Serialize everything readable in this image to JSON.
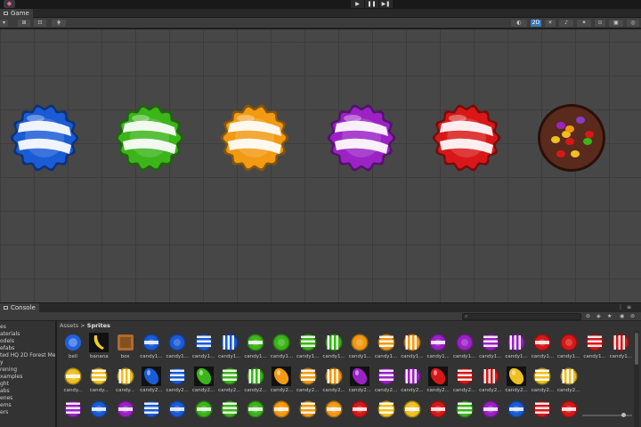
{
  "toolbar": {
    "play": "▶",
    "pause": "❚❚",
    "step": "▶❚"
  },
  "game_tab": {
    "label": "Game"
  },
  "scene_toolbar": {
    "mode_2d": "2D"
  },
  "scene_candies": [
    {
      "name": "blue",
      "color": "#1a5bd6"
    },
    {
      "name": "green",
      "color": "#3bb51a"
    },
    {
      "name": "orange",
      "color": "#f29a12"
    },
    {
      "name": "purple",
      "color": "#9b22c4"
    },
    {
      "name": "red",
      "color": "#d81818"
    },
    {
      "name": "chocolate",
      "color": "#5a2a1c"
    }
  ],
  "console_tab": {
    "label": "Console"
  },
  "project": {
    "breadcrumb_root": "Assets",
    "breadcrumb_sep": ">",
    "breadcrumb_current": "Sprites",
    "search_placeholder": "",
    "tree": [
      "es",
      "aterials",
      "odels",
      "efabs",
      "ted HQ 2D Forest Med",
      "y",
      "rening",
      "xamples",
      "ght",
      "abs",
      "enes",
      "ems",
      "ers"
    ],
    "row1": [
      {
        "label": "bell",
        "color": "#2060e0",
        "kind": "bell"
      },
      {
        "label": "banana",
        "color": "#f0d020",
        "kind": "banana"
      },
      {
        "label": "box",
        "color": "#b06a2c",
        "kind": "box"
      },
      {
        "label": "candy1...",
        "color": "#1a5bd6",
        "kind": "wrap"
      },
      {
        "label": "candy1...",
        "color": "#1a5bd6",
        "kind": "round"
      },
      {
        "label": "candy1...",
        "color": "#1a5bd6",
        "kind": "stripe"
      },
      {
        "label": "candy1...",
        "color": "#1a5bd6",
        "kind": "stripev"
      },
      {
        "label": "candy1...",
        "color": "#3bb51a",
        "kind": "wrap"
      },
      {
        "label": "candy1...",
        "color": "#3bb51a",
        "kind": "round"
      },
      {
        "label": "candy1...",
        "color": "#3bb51a",
        "kind": "stripe"
      },
      {
        "label": "candy1...",
        "color": "#3bb51a",
        "kind": "stripev"
      },
      {
        "label": "candy1...",
        "color": "#f29a12",
        "kind": "round"
      },
      {
        "label": "candy1...",
        "color": "#f29a12",
        "kind": "stripe"
      },
      {
        "label": "candy1...",
        "color": "#f29a12",
        "kind": "stripev"
      },
      {
        "label": "candy1...",
        "color": "#9b22c4",
        "kind": "wrap"
      },
      {
        "label": "candy1...",
        "color": "#9b22c4",
        "kind": "round"
      },
      {
        "label": "candy1...",
        "color": "#9b22c4",
        "kind": "stripe"
      },
      {
        "label": "candy1...",
        "color": "#9b22c4",
        "kind": "stripev"
      },
      {
        "label": "candy1...",
        "color": "#d81818",
        "kind": "wrap"
      },
      {
        "label": "candy1...",
        "color": "#d81818",
        "kind": "round"
      },
      {
        "label": "candy1...",
        "color": "#d81818",
        "kind": "stripe"
      },
      {
        "label": "candy1...",
        "color": "#d81818",
        "kind": "stripev"
      }
    ],
    "row2": [
      {
        "label": "candy...",
        "color": "#f0c020",
        "kind": "wrap"
      },
      {
        "label": "candy...",
        "color": "#f0c020",
        "kind": "stripe"
      },
      {
        "label": "candy...",
        "color": "#f0c020",
        "kind": "stripev"
      },
      {
        "label": "candy2...",
        "color": "#1a5bd6",
        "kind": "bean"
      },
      {
        "label": "candy2...",
        "color": "#1a5bd6",
        "kind": "stripe"
      },
      {
        "label": "candy2...",
        "color": "#3bb51a",
        "kind": "bean"
      },
      {
        "label": "candy2...",
        "color": "#3bb51a",
        "kind": "stripe"
      },
      {
        "label": "candy2...",
        "color": "#3bb51a",
        "kind": "stripev"
      },
      {
        "label": "candy2...",
        "color": "#f29a12",
        "kind": "bean"
      },
      {
        "label": "candy2...",
        "color": "#f29a12",
        "kind": "stripe"
      },
      {
        "label": "candy2...",
        "color": "#f29a12",
        "kind": "stripev"
      },
      {
        "label": "candy2...",
        "color": "#9b22c4",
        "kind": "bean"
      },
      {
        "label": "candy2...",
        "color": "#9b22c4",
        "kind": "stripe"
      },
      {
        "label": "candy2...",
        "color": "#9b22c4",
        "kind": "stripev"
      },
      {
        "label": "candy2...",
        "color": "#d81818",
        "kind": "bean"
      },
      {
        "label": "candy2...",
        "color": "#d81818",
        "kind": "stripe"
      },
      {
        "label": "candy2...",
        "color": "#d81818",
        "kind": "stripev"
      },
      {
        "label": "candy2...",
        "color": "#f0c020",
        "kind": "bean"
      },
      {
        "label": "candy2...",
        "color": "#f0c020",
        "kind": "stripe"
      },
      {
        "label": "candy2...",
        "color": "#f0c020",
        "kind": "stripev"
      }
    ],
    "row3": [
      "#9b22c4",
      "#1a5bd6",
      "#9b22c4",
      "#1a5bd6",
      "#1a5bd6",
      "#3bb51a",
      "#3bb51a",
      "#3bb51a",
      "#f29a12",
      "#f29a12",
      "#f29a12",
      "#d81818",
      "#f0c020",
      "#f0c020",
      "#d81818",
      "#3bb51a",
      "#9b22c4",
      "#1a5bd6",
      "#d81818",
      "#d81818"
    ]
  }
}
